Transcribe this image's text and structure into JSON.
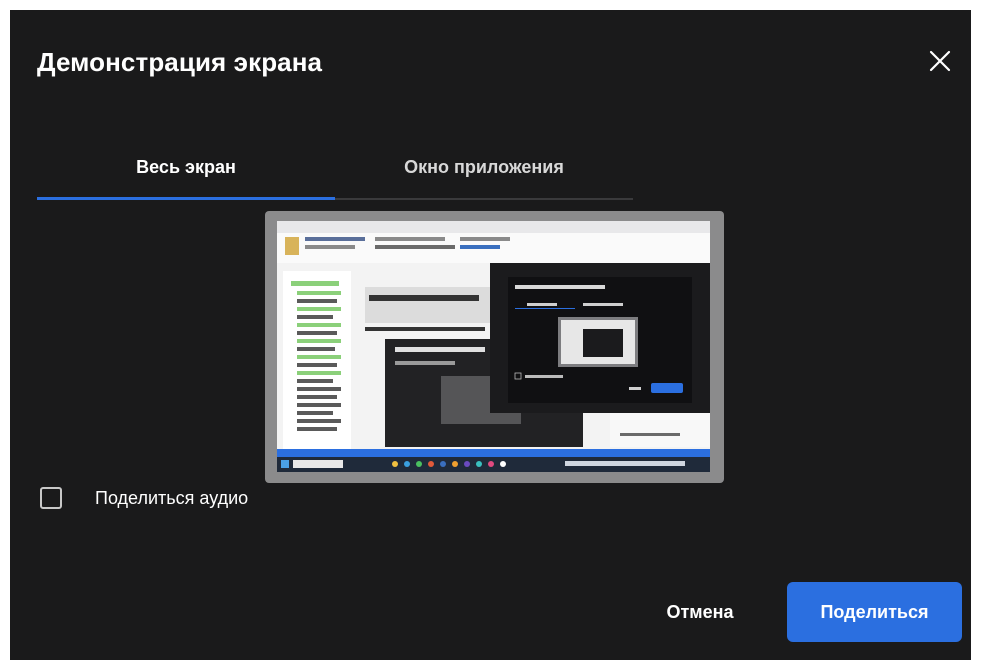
{
  "dialog": {
    "title": "Демонстрация экрана",
    "close_icon": "close-icon"
  },
  "tabs": [
    {
      "label": "Весь экран",
      "active": true
    },
    {
      "label": "Окно приложения",
      "active": false
    }
  ],
  "preview": {
    "icon": "screen-preview-thumbnail"
  },
  "audio": {
    "label": "Поделиться аудио",
    "checked": false
  },
  "actions": {
    "cancel_label": "Отмена",
    "share_label": "Поделиться"
  },
  "colors": {
    "background": "#1a1a1b",
    "accent": "#2b6fe0",
    "text": "#ffffff",
    "tab_divider": "#3a3a3c"
  }
}
